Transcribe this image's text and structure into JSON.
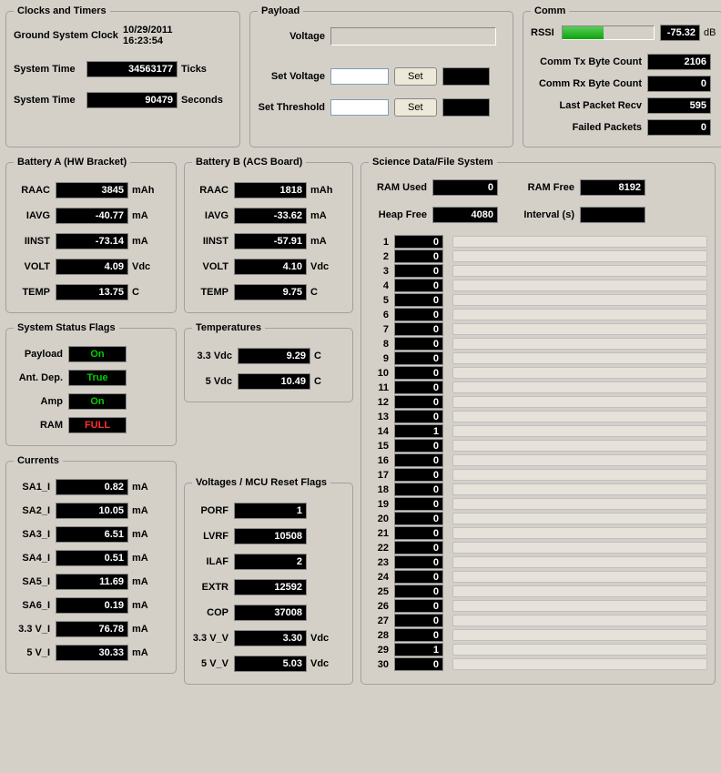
{
  "clocks": {
    "legend": "Clocks and Timers",
    "gsc_label": "Ground System Clock",
    "gsc_date": "10/29/2011",
    "gsc_time": "16:23:54",
    "systime1_label": "System Time",
    "systime1_val": "34563177",
    "systime1_unit": "Ticks",
    "systime2_label": "System Time",
    "systime2_val": "90479",
    "systime2_unit": "Seconds"
  },
  "payload": {
    "legend": "Payload",
    "voltage_label": "Voltage",
    "set_voltage_label": "Set Voltage",
    "set_threshold_label": "Set Threshold",
    "set_button": "Set"
  },
  "comm": {
    "legend": "Comm",
    "rssi_label": "RSSI",
    "rssi_val": "-75.32",
    "rssi_unit": "dB",
    "rssi_pct": 45,
    "tx_label": "Comm Tx Byte Count",
    "tx_val": "2106",
    "rx_label": "Comm Rx Byte Count",
    "rx_val": "0",
    "last_label": "Last Packet Recv",
    "last_val": "595",
    "failed_label": "Failed Packets",
    "failed_val": "0"
  },
  "batA": {
    "legend": "Battery A (HW Bracket)",
    "rows": [
      {
        "label": "RAAC",
        "val": "3845",
        "unit": "mAh"
      },
      {
        "label": "IAVG",
        "val": "-40.77",
        "unit": "mA"
      },
      {
        "label": "IINST",
        "val": "-73.14",
        "unit": "mA"
      },
      {
        "label": "VOLT",
        "val": "4.09",
        "unit": "Vdc"
      },
      {
        "label": "TEMP",
        "val": "13.75",
        "unit": "C"
      }
    ]
  },
  "batB": {
    "legend": "Battery B (ACS Board)",
    "rows": [
      {
        "label": "RAAC",
        "val": "1818",
        "unit": "mAh"
      },
      {
        "label": "IAVG",
        "val": "-33.62",
        "unit": "mA"
      },
      {
        "label": "IINST",
        "val": "-57.91",
        "unit": "mA"
      },
      {
        "label": "VOLT",
        "val": "4.10",
        "unit": "Vdc"
      },
      {
        "label": "TEMP",
        "val": "9.75",
        "unit": "C"
      }
    ]
  },
  "flags": {
    "legend": "System Status Flags",
    "rows": [
      {
        "label": "Payload",
        "val": "On",
        "cls": "val-green"
      },
      {
        "label": "Ant. Dep.",
        "val": "True",
        "cls": "val-green"
      },
      {
        "label": "Amp",
        "val": "On",
        "cls": "val-green"
      },
      {
        "label": "RAM",
        "val": "FULL",
        "cls": "val-red"
      }
    ]
  },
  "temps": {
    "legend": "Temperatures",
    "rows": [
      {
        "label": "3.3 Vdc",
        "val": "9.29",
        "unit": "C"
      },
      {
        "label": "5 Vdc",
        "val": "10.49",
        "unit": "C"
      }
    ]
  },
  "currents": {
    "legend": "Currents",
    "rows": [
      {
        "label": "SA1_I",
        "val": "0.82",
        "unit": "mA"
      },
      {
        "label": "SA2_I",
        "val": "10.05",
        "unit": "mA"
      },
      {
        "label": "SA3_I",
        "val": "6.51",
        "unit": "mA"
      },
      {
        "label": "SA4_I",
        "val": "0.51",
        "unit": "mA"
      },
      {
        "label": "SA5_I",
        "val": "11.69",
        "unit": "mA"
      },
      {
        "label": "SA6_I",
        "val": "0.19",
        "unit": "mA"
      },
      {
        "label": "3.3 V_I",
        "val": "76.78",
        "unit": "mA"
      },
      {
        "label": "5 V_I",
        "val": "30.33",
        "unit": "mA"
      }
    ]
  },
  "vmcu": {
    "legend": "Voltages / MCU Reset Flags",
    "rows": [
      {
        "label": "PORF",
        "val": "1",
        "unit": ""
      },
      {
        "label": "LVRF",
        "val": "10508",
        "unit": ""
      },
      {
        "label": "ILAF",
        "val": "2",
        "unit": ""
      },
      {
        "label": "EXTR",
        "val": "12592",
        "unit": ""
      },
      {
        "label": "COP",
        "val": "37008",
        "unit": ""
      },
      {
        "label": "3.3 V_V",
        "val": "3.30",
        "unit": "Vdc"
      },
      {
        "label": "5 V_V",
        "val": "5.03",
        "unit": "Vdc"
      }
    ]
  },
  "science": {
    "legend": "Science Data/File System",
    "ram_used_label": "RAM Used",
    "ram_used_val": "0",
    "ram_free_label": "RAM Free",
    "ram_free_val": "8192",
    "heap_free_label": "Heap Free",
    "heap_free_val": "4080",
    "interval_label": "Interval (s)",
    "interval_val": "",
    "items": [
      {
        "n": "1",
        "v": "0"
      },
      {
        "n": "2",
        "v": "0"
      },
      {
        "n": "3",
        "v": "0"
      },
      {
        "n": "4",
        "v": "0"
      },
      {
        "n": "5",
        "v": "0"
      },
      {
        "n": "6",
        "v": "0"
      },
      {
        "n": "7",
        "v": "0"
      },
      {
        "n": "8",
        "v": "0"
      },
      {
        "n": "9",
        "v": "0"
      },
      {
        "n": "10",
        "v": "0"
      },
      {
        "n": "11",
        "v": "0"
      },
      {
        "n": "12",
        "v": "0"
      },
      {
        "n": "13",
        "v": "0"
      },
      {
        "n": "14",
        "v": "1"
      },
      {
        "n": "15",
        "v": "0"
      },
      {
        "n": "16",
        "v": "0"
      },
      {
        "n": "17",
        "v": "0"
      },
      {
        "n": "18",
        "v": "0"
      },
      {
        "n": "19",
        "v": "0"
      },
      {
        "n": "20",
        "v": "0"
      },
      {
        "n": "21",
        "v": "0"
      },
      {
        "n": "22",
        "v": "0"
      },
      {
        "n": "23",
        "v": "0"
      },
      {
        "n": "24",
        "v": "0"
      },
      {
        "n": "25",
        "v": "0"
      },
      {
        "n": "26",
        "v": "0"
      },
      {
        "n": "27",
        "v": "0"
      },
      {
        "n": "28",
        "v": "0"
      },
      {
        "n": "29",
        "v": "1"
      },
      {
        "n": "30",
        "v": "0"
      }
    ]
  }
}
